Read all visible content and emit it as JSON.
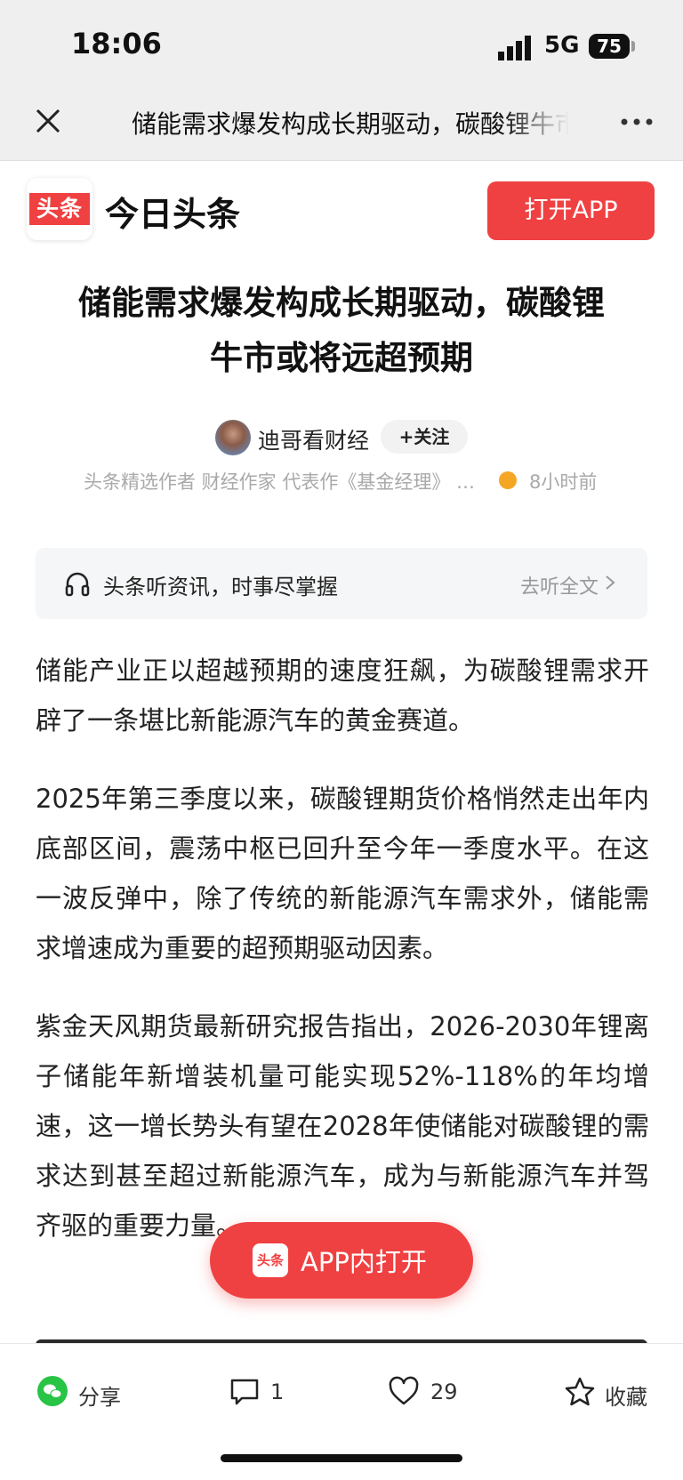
{
  "status_bar": {
    "time": "18:06",
    "network": "5G",
    "battery": "75"
  },
  "nav_bar": {
    "title": "储能需求爆发构成长期驱动，碳酸锂牛市或将远超预期"
  },
  "brand": {
    "logo_text": "头条",
    "name": "今日头条",
    "open_app_label": "打开APP",
    "accent_color": "#f04142"
  },
  "article": {
    "headline": "储能需求爆发构成长期驱动，碳酸锂牛市或将远超预期",
    "author": "迪哥看财经",
    "follow_label": "+关注",
    "author_desc": "头条精选作者 财经作家 代表作《基金经理》 …",
    "time_ago": "8小时前",
    "paragraphs": [
      "储能产业正以超越预期的速度狂飙，为碳酸锂需求开辟了一条堪比新能源汽车的黄金赛道。",
      "2025年第三季度以来，碳酸锂期货价格悄然走出年内底部区间，震荡中枢已回升至今年一季度水平。在这一波反弹中，除了传统的新能源汽车需求外，储能需求增速成为重要的超预期驱动因素。",
      "紫金天风期货最新研究报告指出，2026-2030年锂离子储能年新增装机量可能实现52%-118%的年均增速，这一增长势头有望在2028年使储能对碳酸锂的需求达到甚至超过新能源汽车，成为与新能源汽车并驾齐驱的重要力量。"
    ]
  },
  "listen_bar": {
    "text": "头条听资讯，时事尽掌握",
    "link": "去听全文"
  },
  "floating_button": {
    "logo_text": "头条",
    "label": "APP内打开"
  },
  "bottom_bar": {
    "share": "分享",
    "comments": "1",
    "likes": "29",
    "favorite": "收藏"
  }
}
